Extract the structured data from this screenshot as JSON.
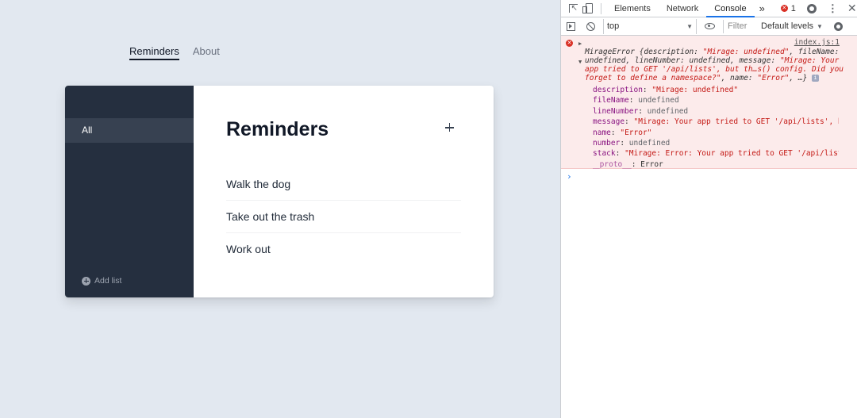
{
  "app": {
    "nav": [
      {
        "label": "Reminders",
        "active": true
      },
      {
        "label": "About",
        "active": false
      }
    ],
    "sidebar": {
      "items": [
        {
          "label": "All",
          "selected": true
        }
      ],
      "add_list_label": "Add list"
    },
    "main": {
      "title": "Reminders",
      "reminders": [
        "Walk the dog",
        "Take out the trash",
        "Work out"
      ]
    }
  },
  "devtools": {
    "tabs": [
      "Elements",
      "Network",
      "Console"
    ],
    "active_tab": "Console",
    "more_tabs": "»",
    "error_count": "1",
    "toolbar": {
      "context": "top",
      "filter_placeholder": "Filter",
      "levels": "Default levels"
    },
    "console": {
      "source": "index.js:1",
      "summary_prefix": "MirageError {description: ",
      "summary_desc": "\"Mirage: undefined\"",
      "summary_mid1": ", fileName: undefined, lineNumber: undefined, message: ",
      "summary_msg": "\"Mirage: Your app tried to GET '/api/lists', but th…s() config. Did you forget to define a namespace?\"",
      "summary_mid2": ", name: ",
      "summary_name": "\"Error\"",
      "summary_end": ", …}",
      "props": [
        {
          "key": "description",
          "value": "\"Mirage: undefined\"",
          "type": "string"
        },
        {
          "key": "fileName",
          "value": "undefined",
          "type": "undefined"
        },
        {
          "key": "lineNumber",
          "value": "undefined",
          "type": "undefined"
        },
        {
          "key": "message",
          "value": "\"Mirage: Your app tried to GET '/api/lists', b…",
          "type": "string"
        },
        {
          "key": "name",
          "value": "\"Error\"",
          "type": "string"
        },
        {
          "key": "number",
          "value": "undefined",
          "type": "undefined"
        },
        {
          "key": "stack",
          "value": "\"Mirage: Error: Your app tried to GET '/api/list…",
          "type": "string"
        }
      ],
      "proto_key": "__proto__",
      "proto_value": "Error",
      "prompt": "›"
    }
  },
  "colors": {
    "page_bg": "#e2e8f0",
    "sidebar_bg": "#252f3f",
    "sidebar_selected": "#374151",
    "error_bg": "#fcebeb",
    "accent": "#1a73e8"
  }
}
